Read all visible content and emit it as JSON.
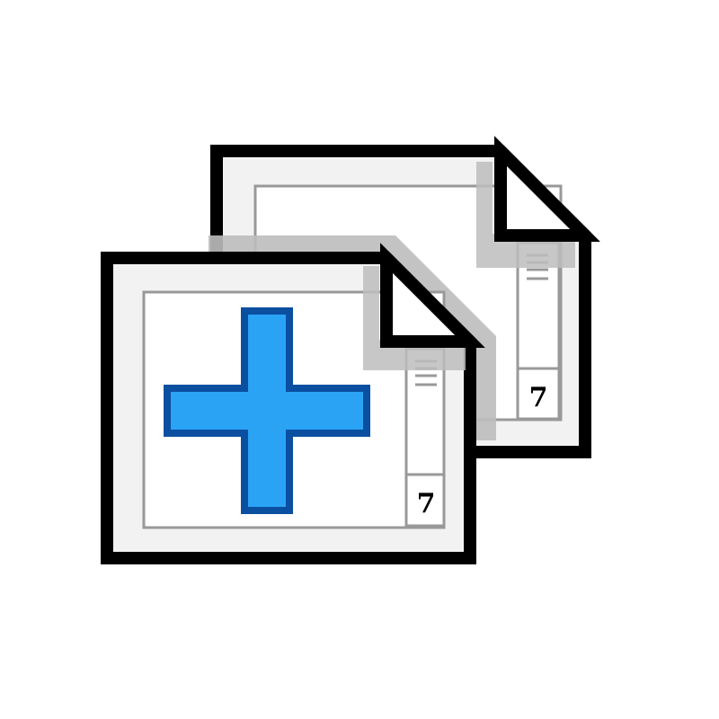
{
  "icon": {
    "name": "new-duplicate-page-icon",
    "back_page": {
      "number": "7"
    },
    "front_page": {
      "number": "7"
    },
    "plus": {
      "name": "plus-icon"
    }
  },
  "colors": {
    "outline": "#000000",
    "page_fill": "#ffffff",
    "page_margin_fill": "#f2f2f2",
    "guide_line": "#999999",
    "fold_shadow": "#bdbdbd",
    "plus_fill": "#2aa3f5",
    "plus_stroke": "#0a4fa0"
  }
}
